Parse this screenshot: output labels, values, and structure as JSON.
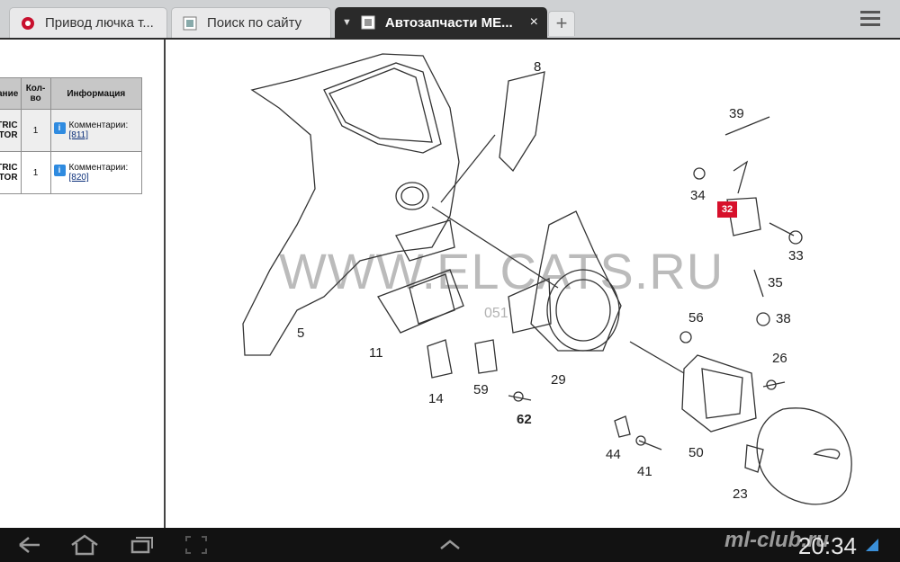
{
  "tabs": [
    {
      "title": "Привод лючка т...",
      "active": false
    },
    {
      "title": "Поиск по сайту",
      "active": false
    },
    {
      "title": "Автозапчасти МЕ...",
      "active": true
    }
  ],
  "tab_close": "×",
  "new_tab": "+",
  "table": {
    "headers": [
      "оп. ание",
      "Кол- во",
      "Информация"
    ],
    "rows": [
      {
        "name": "TRIC TOR",
        "qty": "1",
        "info_label": "Комментарии:",
        "info_link": "[811]"
      },
      {
        "name": "TRIC TOR",
        "qty": "1",
        "info_label": "Комментарии:",
        "info_link": "[820]"
      }
    ]
  },
  "diagram": {
    "watermark": "WWW.ELCATS.RU",
    "watermark_small": "051",
    "highlight_part": "32",
    "part_numbers": [
      "8",
      "39",
      "34",
      "33",
      "35",
      "56",
      "38",
      "26",
      "5",
      "11",
      "14",
      "59",
      "29",
      "62",
      "44",
      "41",
      "50",
      "23"
    ]
  },
  "status": {
    "clock": "20:34",
    "forum_watermark": "ml-club.ru"
  },
  "colors": {
    "accent": "#d7102b",
    "tab_active": "#2a2a2a",
    "navbar": "#121212"
  }
}
